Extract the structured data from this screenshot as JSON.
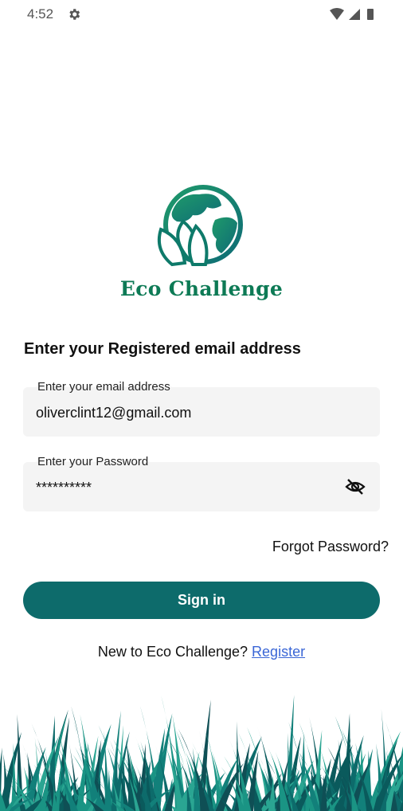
{
  "status_bar": {
    "time": "4:52",
    "icons": [
      "gear-icon",
      "wifi-icon",
      "signal-icon",
      "battery-icon"
    ]
  },
  "brand": {
    "name": "Eco Challenge",
    "logo_icon": "globe-leaves-logo",
    "colors": {
      "primary": "#0d6b6b",
      "brand_text": "#0d7a55"
    }
  },
  "form": {
    "heading": "Enter your Registered email address",
    "email": {
      "label": "Enter your email address",
      "value": "oliverclint12@gmail.com"
    },
    "password": {
      "label": "Enter your Password",
      "value": "**********",
      "toggle_icon": "eye-off-icon"
    },
    "forgot_label": "Forgot Password?",
    "signin_label": "Sign in",
    "register_prompt": "New to Eco Challenge?",
    "register_link": "Register"
  }
}
